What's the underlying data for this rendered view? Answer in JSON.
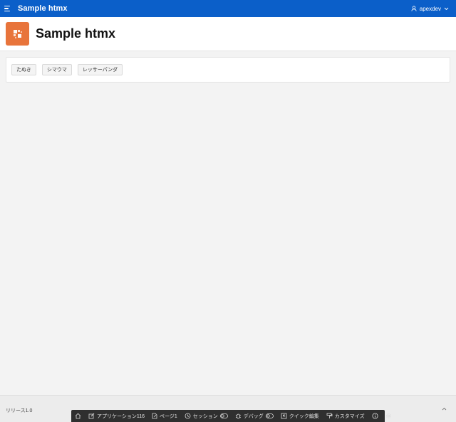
{
  "header": {
    "app_title": "Sample htmx",
    "user_name": "apexdev",
    "colors": {
      "bar": "#0b5fc9",
      "text": "#ffffff"
    }
  },
  "hero": {
    "title": "Sample htmx",
    "icon": "app-grid-icon",
    "icon_color": "#e8743b"
  },
  "buttons": [
    {
      "label": "たぬき"
    },
    {
      "label": "シマウマ"
    },
    {
      "label": "レッサーパンダ"
    }
  ],
  "footer": {
    "release": "リリース1.0"
  },
  "dev_toolbar": {
    "home_icon": "home-icon",
    "application": "アプリケーション116",
    "page": "ページ1",
    "session": "セッション",
    "debug": "デバッグ",
    "quick_edit": "クイック編集",
    "customize": "カスタマイズ"
  }
}
